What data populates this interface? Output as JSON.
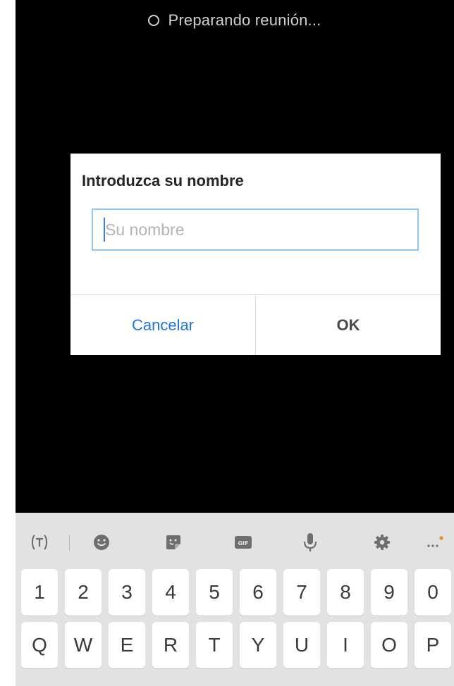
{
  "status": {
    "text": "Preparando reunión...",
    "icon": "loading-circle-icon"
  },
  "dialog": {
    "title": "Introduzca su nombre",
    "input": {
      "value": "",
      "placeholder": "Su nombre"
    },
    "buttons": {
      "cancel": "Cancelar",
      "ok": "OK"
    }
  },
  "keyboard": {
    "toolbar": [
      "translate-icon",
      "emoji-icon",
      "sticker-icon",
      "gif-icon",
      "microphone-icon",
      "settings-gear-icon",
      "more-options-icon"
    ],
    "number_row": [
      "1",
      "2",
      "3",
      "4",
      "5",
      "6",
      "7",
      "8",
      "9",
      "0"
    ],
    "letter_row": [
      "Q",
      "W",
      "E",
      "R",
      "T",
      "Y",
      "U",
      "I",
      "O",
      "P"
    ]
  },
  "colors": {
    "accent": "#1f73e8",
    "input_border": "#8dc6f2",
    "background": "#000000",
    "keyboard": "#e2e2e2",
    "notification_dot": "#f08a24"
  }
}
